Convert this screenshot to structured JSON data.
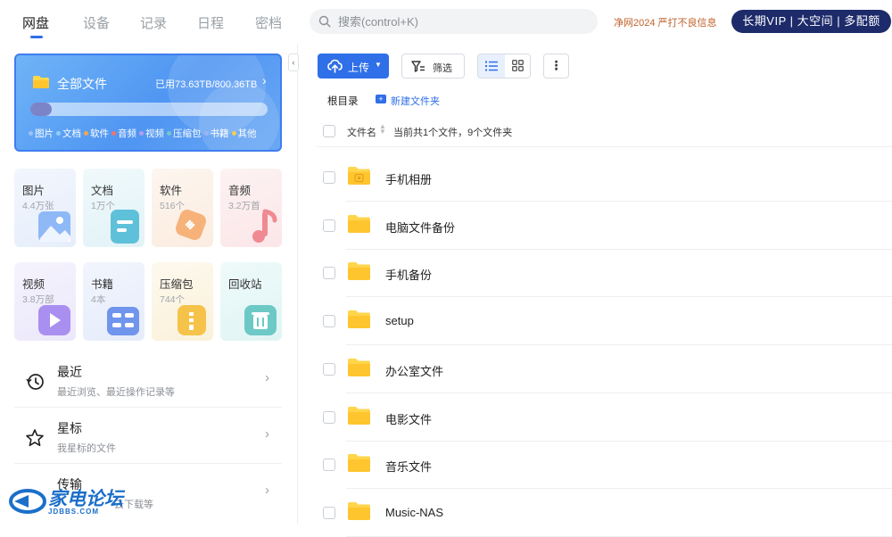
{
  "nav": {
    "tabs": [
      {
        "label": "网盘",
        "active": true
      },
      {
        "label": "设备",
        "active": false
      },
      {
        "label": "记录",
        "active": false
      },
      {
        "label": "日程",
        "active": false
      },
      {
        "label": "密档",
        "active": false
      }
    ]
  },
  "search": {
    "placeholder": "搜索(control+K)"
  },
  "notice": "净网2024 严打不良信息",
  "vip_button": "长期VIP | 大空间 | 多配额",
  "colors": {
    "accent": "#2f6fe8",
    "vip": "#1d2b6b",
    "folder": "#ffc52f"
  },
  "all_files": {
    "title": "全部文件",
    "usage": "已用73.63TB/800.36TB",
    "usage_fraction": 0.092,
    "legend": [
      {
        "label": "图片",
        "color": "#9fc3f6"
      },
      {
        "label": "文档",
        "color": "#8fd0f7"
      },
      {
        "label": "软件",
        "color": "#f4a64b"
      },
      {
        "label": "音频",
        "color": "#f07272"
      },
      {
        "label": "视频",
        "color": "#b69cf2"
      },
      {
        "label": "压缩包",
        "color": "#74c7c9"
      },
      {
        "label": "书籍",
        "color": "#9fb5f2"
      },
      {
        "label": "其他",
        "color": "#f3cf52"
      }
    ]
  },
  "categories": [
    {
      "name": "图片",
      "count": "4.4万张",
      "icon": "image-icon"
    },
    {
      "name": "文档",
      "count": "1万个",
      "icon": "document-icon"
    },
    {
      "name": "软件",
      "count": "516个",
      "icon": "software-icon"
    },
    {
      "name": "音频",
      "count": "3.2万首",
      "icon": "music-icon"
    },
    {
      "name": "视频",
      "count": "3.8万部",
      "icon": "video-icon"
    },
    {
      "name": "书籍",
      "count": "4本",
      "icon": "book-icon"
    },
    {
      "name": "压缩包",
      "count": "744个",
      "icon": "archive-icon"
    },
    {
      "name": "回收站",
      "count": "",
      "icon": "trash-icon"
    }
  ],
  "menu": [
    {
      "title": "最近",
      "sub": "最近浏览、最近操作记录等",
      "icon": "history-icon"
    },
    {
      "title": "星标",
      "sub": "我星标的文件",
      "icon": "star-icon"
    },
    {
      "title": "传输",
      "sub": "云下载等",
      "icon": "transfer-icon"
    }
  ],
  "watermark": {
    "brand": "家电论坛",
    "domain": "JDBBS.COM"
  },
  "toolbar": {
    "upload": "上传",
    "filter": "筛选",
    "more": "⋮"
  },
  "breadcrumb": {
    "root": "根目录",
    "new_folder": "新建文件夹"
  },
  "list_header": {
    "name": "文件名",
    "summary": "当前共1个文件，9个文件夹"
  },
  "files": [
    {
      "name": "手机相册",
      "special": true
    },
    {
      "name": "电脑文件备份",
      "special": false
    },
    {
      "name": "手机备份",
      "special": false
    },
    {
      "name": "setup",
      "special": false
    },
    {
      "name": "办公室文件",
      "special": false
    },
    {
      "name": "电影文件",
      "special": false
    },
    {
      "name": "音乐文件",
      "special": false
    },
    {
      "name": "Music-NAS",
      "special": false
    }
  ]
}
